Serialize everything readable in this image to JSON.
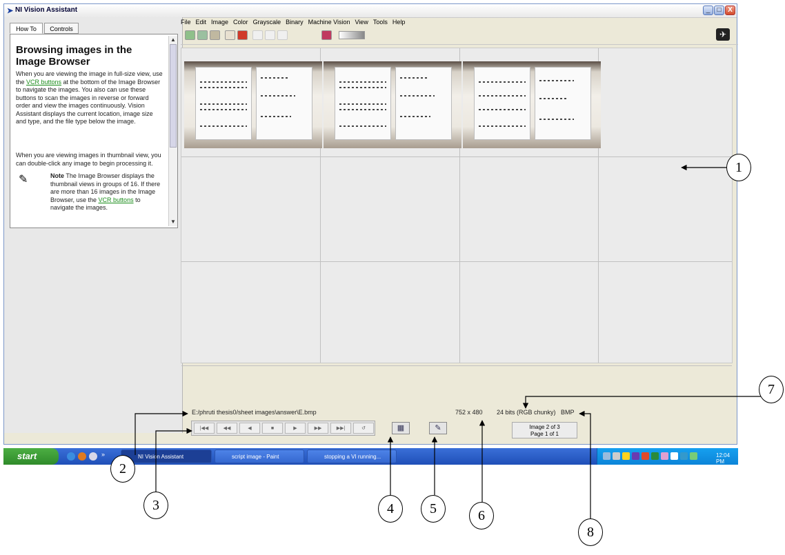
{
  "window": {
    "title": "NI Vision Assistant",
    "controls": [
      "_",
      "□",
      "X"
    ]
  },
  "left_panel": {
    "tabs": [
      "How To",
      "Controls"
    ],
    "help": {
      "title": "Browsing images in the Image Browser",
      "p1_a": "When you are viewing the image in full-size view, use the ",
      "p1_link": "VCR buttons",
      "p1_b": " at the bottom of the Image Browser to navigate the images. You also can use these buttons to scan the images in reverse or forward order and view the images continuously. Vision Assistant displays the current location, image size and type, and the file type below the image.",
      "p2": "When you are viewing images in thumbnail view, you can double-click any image to begin processing it.",
      "note_label": "Note",
      "note_a": " The Image Browser displays the thumbnail views in groups of 16. If there are more than 16 images in the Image Browser, use the ",
      "note_link": "VCR buttons",
      "note_b": " to navigate the images."
    }
  },
  "menu": [
    "File",
    "Edit",
    "Image",
    "Color",
    "Grayscale",
    "Binary",
    "Machine Vision",
    "View",
    "Tools",
    "Help"
  ],
  "status": {
    "path": "E:/phruti thesis0/sheet images\\answer\\E.bmp",
    "dimensions": "752 x 480",
    "bits": "24 bits (RGB chunky)",
    "format": "BMP",
    "image_counter": "Image  2 of 3",
    "page_counter": "Page  1 of 1"
  },
  "vcr_buttons": [
    "|◀◀",
    "◀◀",
    "◀",
    "■",
    "▶",
    "▶▶",
    "▶▶|",
    "↺"
  ],
  "taskbar": {
    "start": "start",
    "buttons": [
      "NI Vision Assistant",
      "script image - Paint",
      "stopping a VI running..."
    ],
    "clock": "12:04 PM"
  },
  "callouts": [
    "1",
    "2",
    "3",
    "4",
    "5",
    "6",
    "7",
    "8"
  ]
}
